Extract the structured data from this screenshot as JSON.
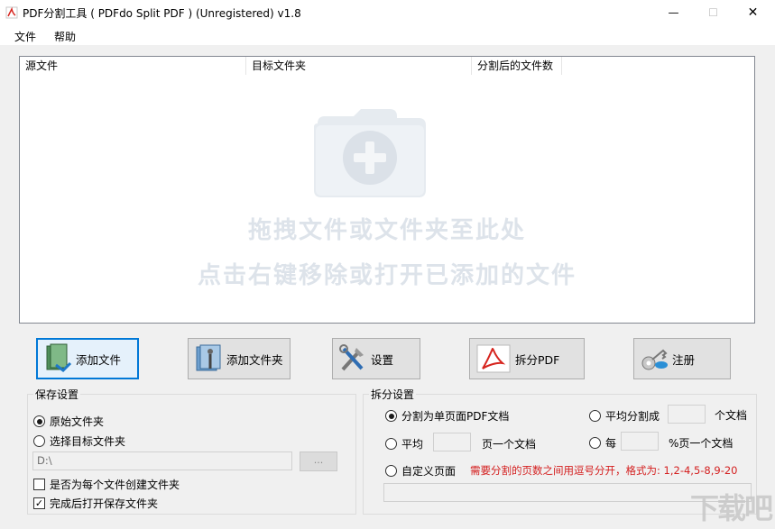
{
  "window": {
    "title": "PDF分割工具 ( PDFdo Split PDF ) (Unregistered) v1.8",
    "minimize": "—",
    "maximize": "☐",
    "close": "✕"
  },
  "menu": [
    "文件",
    "帮助"
  ],
  "list": {
    "columns": [
      "源文件",
      "目标文件夹",
      "分割后的文件数"
    ],
    "hint_line1": "拖拽文件或文件夹至此处",
    "hint_line2": "点击右键移除或打开已添加的文件"
  },
  "buttons": {
    "add_file": "添加文件",
    "add_folder": "添加文件夹",
    "settings": "设置",
    "split_pdf": "拆分PDF",
    "register": "注册"
  },
  "save_settings": {
    "title": "保存设置",
    "original_folder": "原始文件夹",
    "choose_target_folder": "选择目标文件夹",
    "path_value": "D:\\",
    "browse": "...",
    "create_folder_per_file": "是否为每个文件创建文件夹",
    "open_folder_after": "完成后打开保存文件夹"
  },
  "split_settings": {
    "title": "拆分设置",
    "single_page": "分割为单页面PDF文档",
    "average_into": "平均分割成",
    "docs_suffix": "个文档",
    "average": "平均",
    "pages_per_doc": "页一个文档",
    "every": "每",
    "percent_pages_per_doc": "%页一个文档",
    "custom_pages": "自定义页面",
    "custom_hint": "需要分割的页数之间用逗号分开，格式为: 1,2-4,5-8,9-20"
  },
  "watermark": "下载吧",
  "colors": {
    "accent": "#0078d7",
    "hint_red": "#d41f1f",
    "drop_hint": "#dde3ea"
  }
}
